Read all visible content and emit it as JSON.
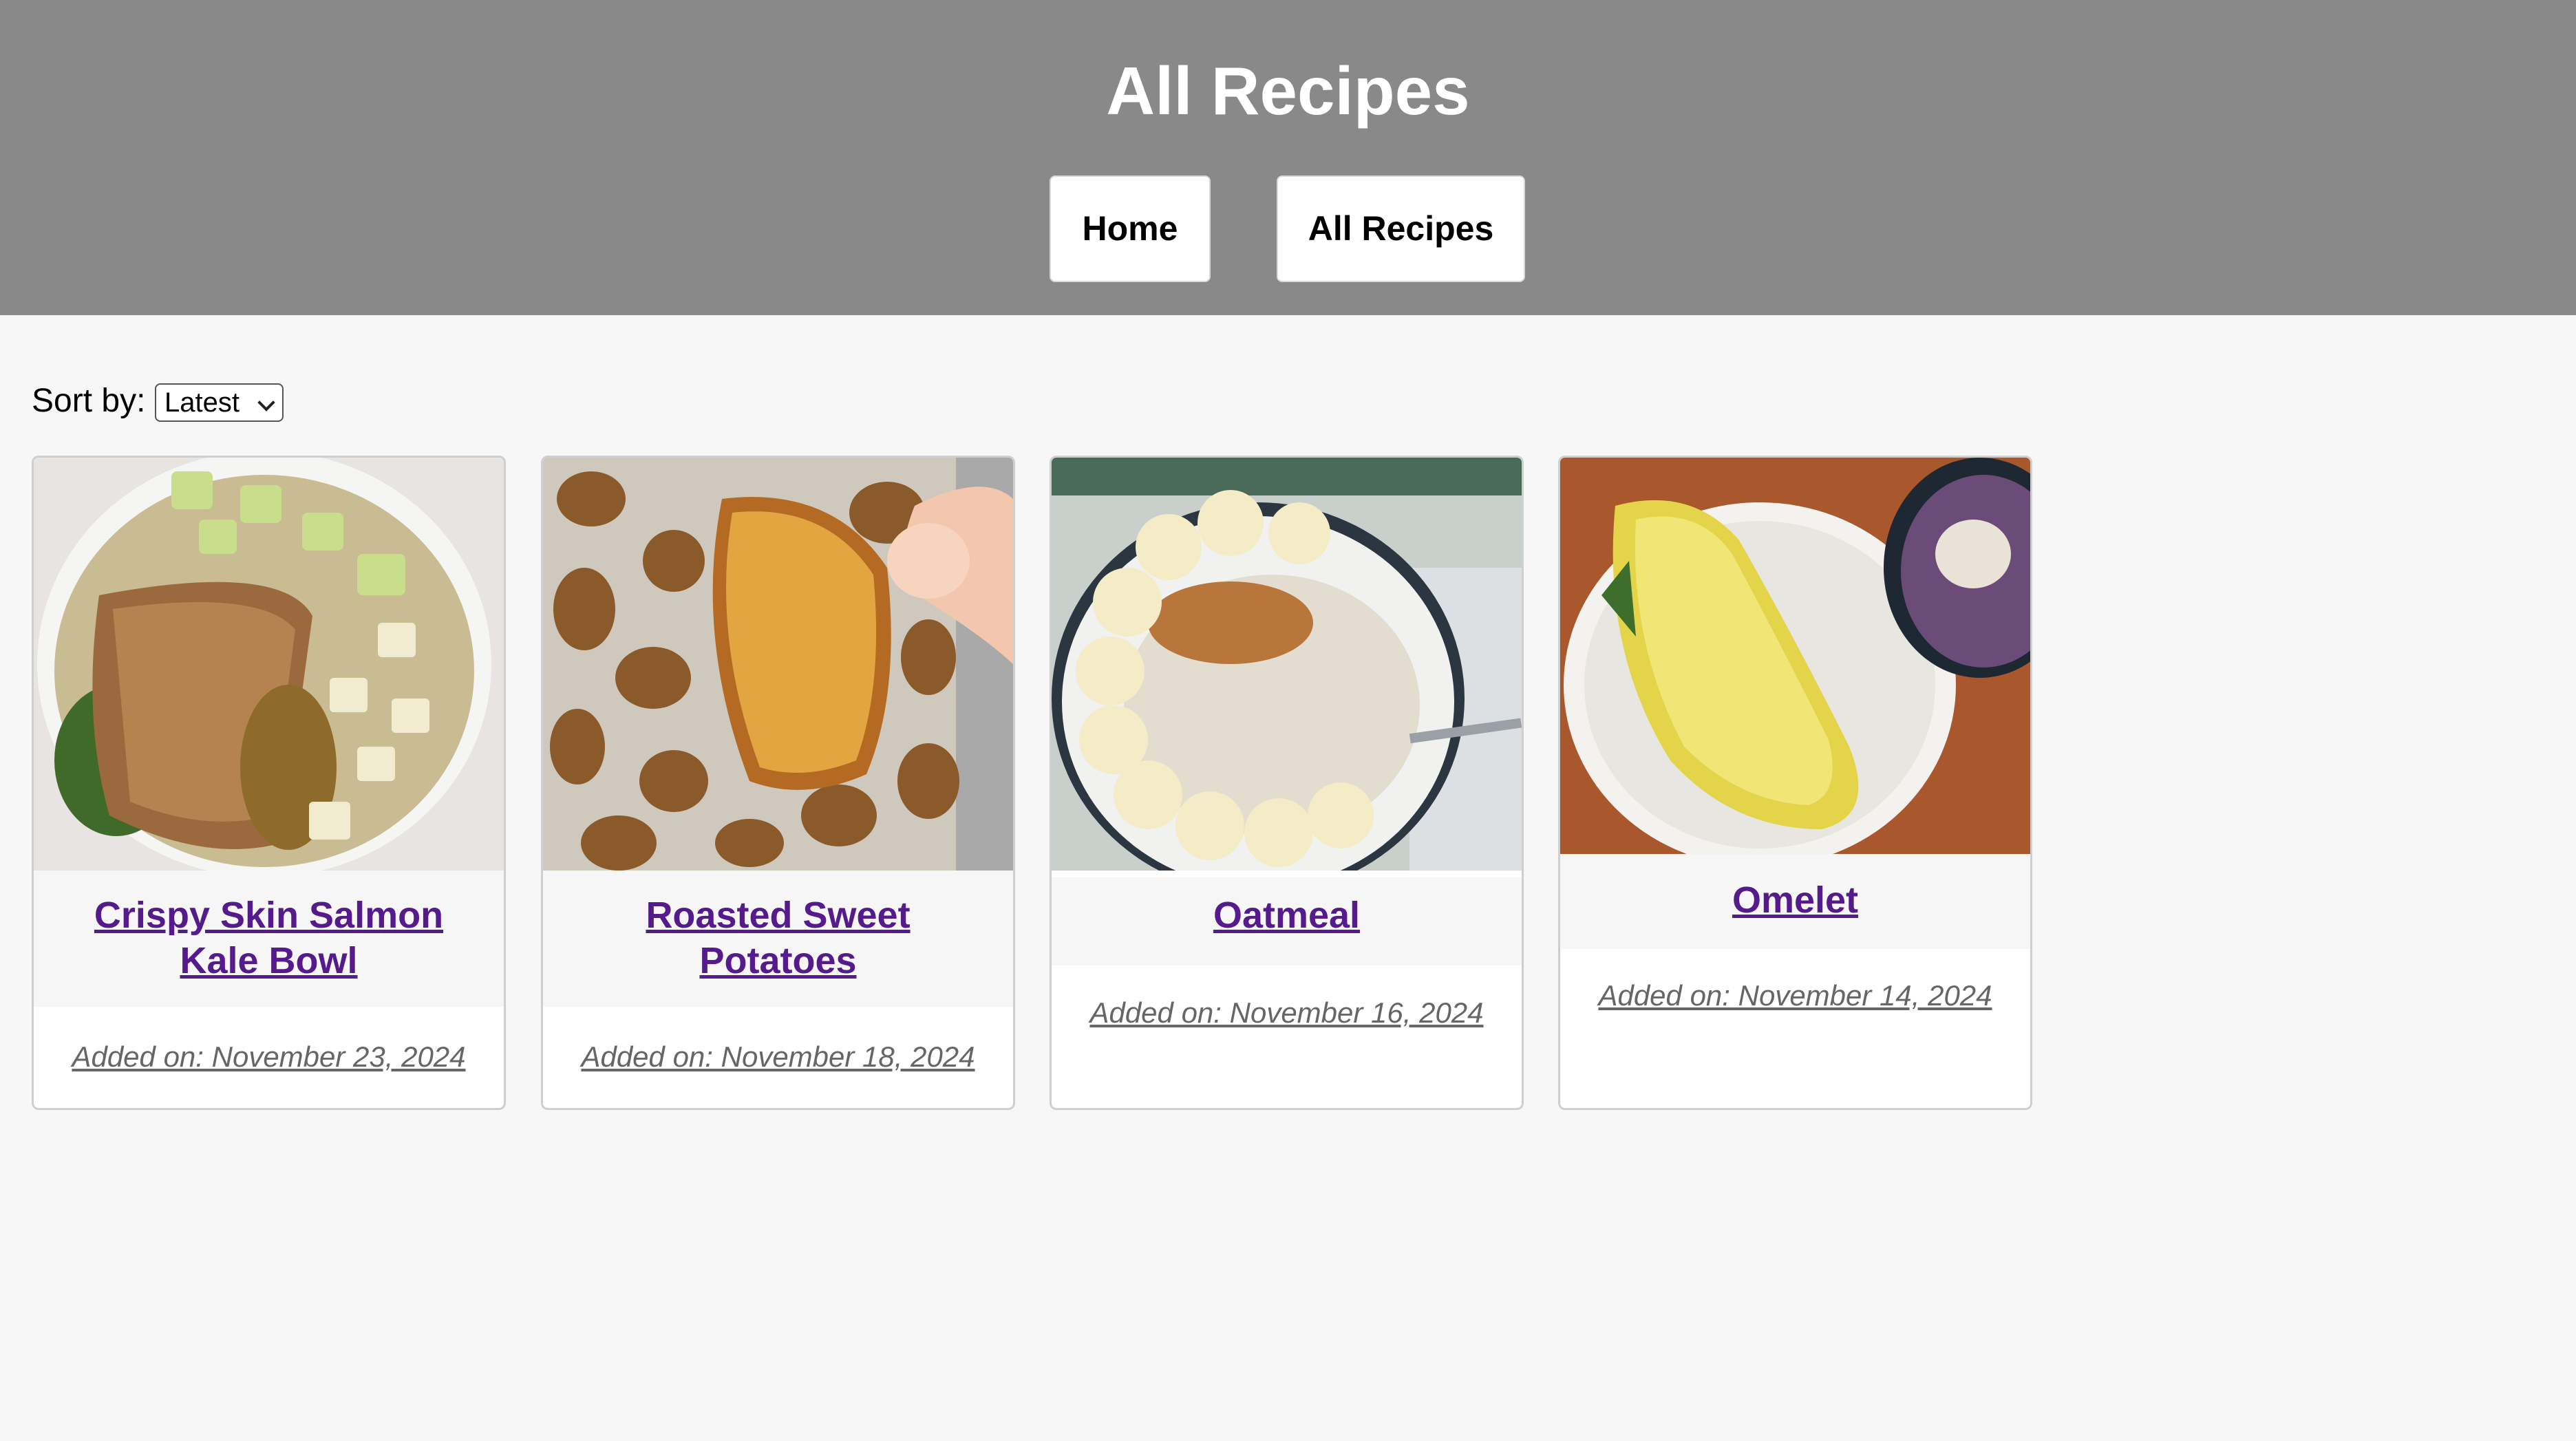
{
  "header": {
    "title": "All Recipes",
    "nav": [
      {
        "label": "Home"
      },
      {
        "label": "All Recipes"
      }
    ]
  },
  "sort": {
    "label": "Sort by:",
    "selected": "Latest"
  },
  "recipes": [
    {
      "title": "Crispy Skin Salmon Kale Bowl",
      "date": "Added on: November 23, 2024"
    },
    {
      "title": "Roasted Sweet Potatoes",
      "date": "Added on: November 18, 2024"
    },
    {
      "title": "Oatmeal",
      "date": "Added on: November 16, 2024"
    },
    {
      "title": "Omelet",
      "date": "Added on: November 14, 2024"
    }
  ],
  "colors": {
    "header_bg": "#898989",
    "page_bg": "#f7f7f7",
    "link": "#551a8b",
    "date_text": "#666666"
  }
}
